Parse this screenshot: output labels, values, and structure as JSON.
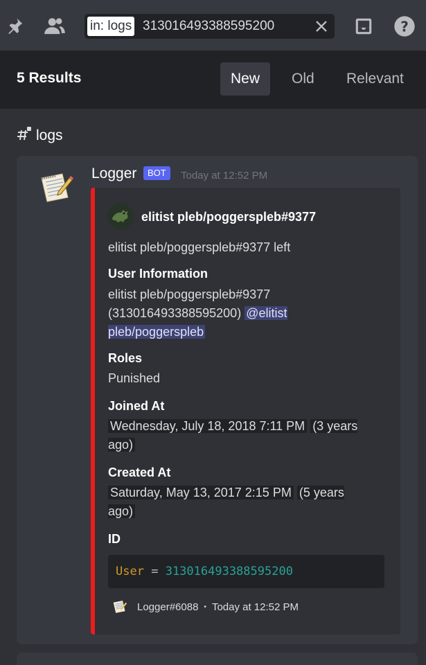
{
  "toolbar": {
    "icons": [
      "pin-icon",
      "members-icon",
      "inbox-icon",
      "help-icon"
    ],
    "search": {
      "filter_chip": "in: logs",
      "value": "313016493388595200",
      "clear_icon": "close-icon"
    }
  },
  "results": {
    "count_label": "5 Results",
    "sort_options": [
      "New",
      "Old",
      "Relevant"
    ],
    "active_sort": "New"
  },
  "channel": {
    "name": "logs"
  },
  "message": {
    "author": "Logger",
    "bot_tag": "BOT",
    "timestamp": "Today at 12:52 PM",
    "embed": {
      "color": "#ed1c1c",
      "author_name": "elitist pleb/poggerspleb#9377",
      "description": "elitist pleb/poggerspleb#9377 left",
      "fields": {
        "user_info": {
          "name": "User Information",
          "line1": "elitist pleb/poggerspleb#9377",
          "line2": "(313016493388595200)",
          "mention": "@elitist pleb/poggerspleb"
        },
        "roles": {
          "name": "Roles",
          "value": "Punished"
        },
        "joined": {
          "name": "Joined At",
          "date": "Wednesday, July 18, 2018 7:11 PM",
          "relative": "(3 years ago)"
        },
        "created": {
          "name": "Created At",
          "date": "Saturday, May 13, 2017 2:15 PM",
          "relative": "(5 years ago)"
        },
        "id": {
          "name": "ID",
          "code_key": "User",
          "code_eq": "=",
          "code_value": "313016493388595200"
        }
      },
      "footer": {
        "text": "Logger#6088",
        "separator": "•",
        "timestamp": "Today at 12:52 PM"
      }
    }
  }
}
